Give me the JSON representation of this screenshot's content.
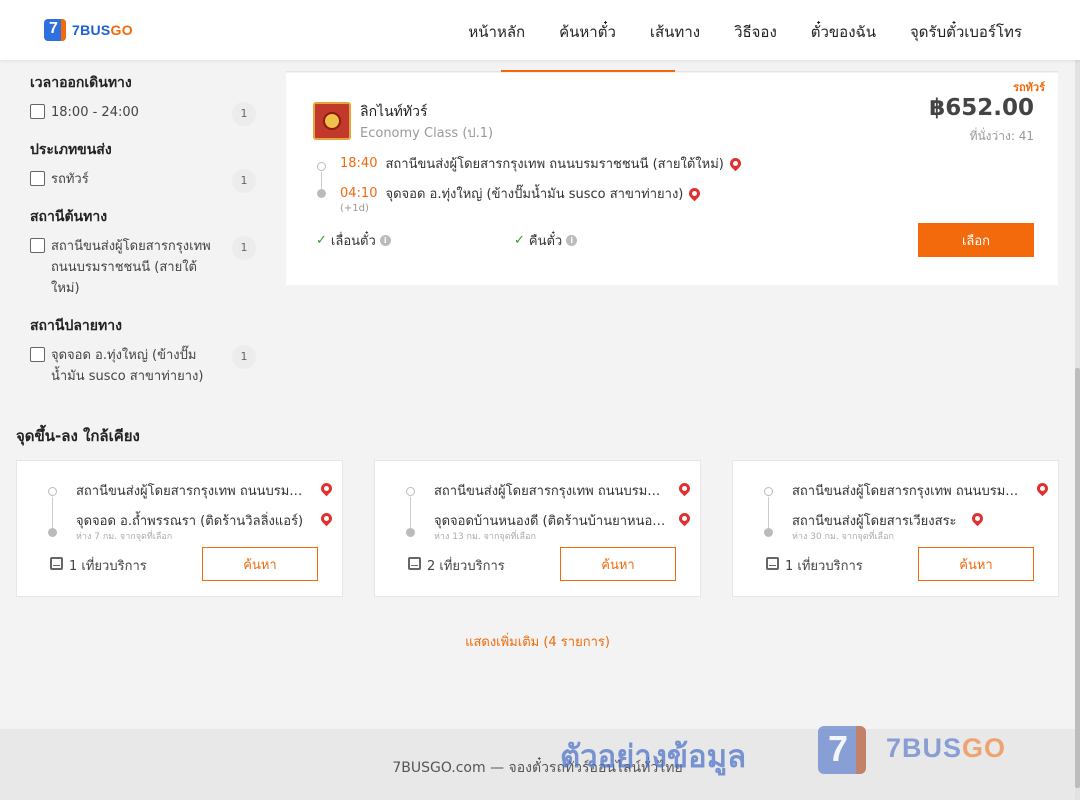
{
  "brand": {
    "name_blue": "7BUS",
    "name_orange": "GO",
    "mark": "7"
  },
  "nav": [
    {
      "label": "หน้าหลัก"
    },
    {
      "label": "ค้นหาตั๋ว"
    },
    {
      "label": "เส้นทาง"
    },
    {
      "label": "วิธีจอง"
    },
    {
      "label": "ตั๋วของฉัน"
    },
    {
      "label": "จุดรับตั๋วเบอร์โทร"
    }
  ],
  "filters": {
    "departure_time": {
      "title": "เวลาออกเดินทาง",
      "options": [
        {
          "label": "18:00 - 24:00",
          "count": "1"
        }
      ]
    },
    "transport_type": {
      "title": "ประเภทขนส่ง",
      "options": [
        {
          "label": "รถทัวร์",
          "count": "1"
        }
      ]
    },
    "origin": {
      "title": "สถานีต้นทาง",
      "options": [
        {
          "label": "สถานีขนส่งผู้โดยสารกรุงเทพ ถนนบรมราชชนนี (สายใต้ใหม่)",
          "count": "1"
        }
      ]
    },
    "destination": {
      "title": "สถานีปลายทาง",
      "options": [
        {
          "label": "จุดจอด อ.ทุ่งใหญ่ (ข้างปั๊มน้ำมัน susco สาขาท่ายาง)",
          "count": "1"
        }
      ]
    }
  },
  "trip": {
    "tag": "รถทัวร์",
    "operator": "ลิกไนท์ทัวร์",
    "bus_class": "Economy Class (ป.1)",
    "price": "฿652.00",
    "seats_label": "ที่นั่งว่าง: 41",
    "depart_time": "18:40",
    "depart_station": "สถานีขนส่งผู้โดยสารกรุงเทพ ถนนบรมราชชนนี (สายใต้ใหม่)",
    "arrive_time": "04:10",
    "arrive_station": "จุดจอด อ.ทุ่งใหญ่ (ข้างปั๊มน้ำมัน susco สาขาท่ายาง)",
    "plus_day": "(+1d)",
    "feature_change": "เลื่อนตั๋ว",
    "feature_refund": "คืนตั๋ว",
    "select_label": "เลือก"
  },
  "nearby": {
    "title": "จุดขึ้น-ลง ใกล้เคียง",
    "cards": [
      {
        "from": "สถานีขนส่งผู้โดยสารกรุงเทพ ถนนบรมราชชนนี (สายใต้ใหม่)",
        "to": "จุดจอด อ.ถ้ำพรรณรา (ติดร้านวิลลิ่งแอร์)",
        "distance": "ห่าง 7 กม. จากจุดที่เลือก",
        "trips": "1 เที่ยวบริการ",
        "button": "ค้นหา"
      },
      {
        "from": "สถานีขนส่งผู้โดยสารกรุงเทพ ถนนบรมราชชนนี (สายใต้ใหม่)",
        "to": "จุดจอดบ้านหนองดี (ติดร้านบ้านยาหนองดี)",
        "distance": "ห่าง 13 กม. จากจุดที่เลือก",
        "trips": "2 เที่ยวบริการ",
        "button": "ค้นหา"
      },
      {
        "from": "สถานีขนส่งผู้โดยสารกรุงเทพ ถนนบรมราชชนนี (สายใต้ใหม่)",
        "to": "สถานีขนส่งผู้โดยสารเวียงสระ",
        "distance": "ห่าง 30 กม. จากจุดที่เลือก",
        "trips": "1 เที่ยวบริการ",
        "button": "ค้นหา"
      }
    ],
    "show_more": "แสดงเพิ่มเติม (4 รายการ)"
  },
  "footer": {
    "text": "7BUSGO.com — จองตั๋วรถทัวร์ออนไลน์ทั่วไทย"
  },
  "watermark": {
    "text": "ตัวอย่างข้อมูล",
    "brand_blue": "7BUS",
    "brand_orange": "GO",
    "mark": "7"
  },
  "colors": {
    "accent": "#f26a0c",
    "brand_blue": "#1d5fd6",
    "pin": "#e03131",
    "check": "#2e9e2e"
  }
}
